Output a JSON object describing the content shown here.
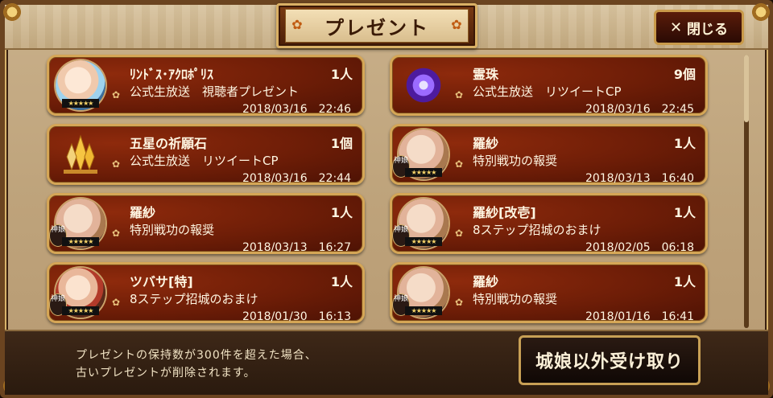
{
  "header": {
    "title": "プレゼント",
    "close_label": "閉じる"
  },
  "presents": [
    {
      "name": "ﾘﾝﾄﾞｽ･ｱｸﾛﾎﾟﾘｽ",
      "qty": "1人",
      "source": "公式生放送　視聴者プレゼント",
      "date": "2018/03/16　22:46",
      "icon": "character-portrait-icon"
    },
    {
      "name": "霊珠",
      "qty": "9個",
      "source": "公式生放送　リツイートCP",
      "date": "2018/03/16　22:45",
      "icon": "spirit-orb-icon"
    },
    {
      "name": "五星の祈願石",
      "qty": "1個",
      "source": "公式生放送　リツイートCP",
      "date": "2018/03/16　22:44",
      "icon": "crystal-icon"
    },
    {
      "name": "羅紗",
      "qty": "1人",
      "source": "特別戦功の報奨",
      "date": "2018/03/13　16:40",
      "icon": "character-portrait-icon"
    },
    {
      "name": "羅紗",
      "qty": "1人",
      "source": "特別戦功の報奨",
      "date": "2018/03/13　16:27",
      "icon": "character-portrait-icon"
    },
    {
      "name": "羅紗[改壱]",
      "qty": "1人",
      "source": "8ステップ招城のおまけ",
      "date": "2018/02/05　06:18",
      "icon": "character-portrait-icon"
    },
    {
      "name": "ツバサ[特]",
      "qty": "1人",
      "source": "8ステップ招城のおまけ",
      "date": "2018/01/30　16:13",
      "icon": "character-portrait-icon"
    },
    {
      "name": "羅紗",
      "qty": "1人",
      "source": "特別戦功の報奨",
      "date": "2018/01/16　16:41",
      "icon": "character-portrait-icon"
    }
  ],
  "badges": {
    "shin": "神娘",
    "stars": "★★★★★"
  },
  "footer": {
    "notice_line1": "プレゼントの保持数が300件を超えた場合、",
    "notice_line2": "古いプレゼントが削除されます。",
    "receive_label": "城娘以外受け取り"
  }
}
